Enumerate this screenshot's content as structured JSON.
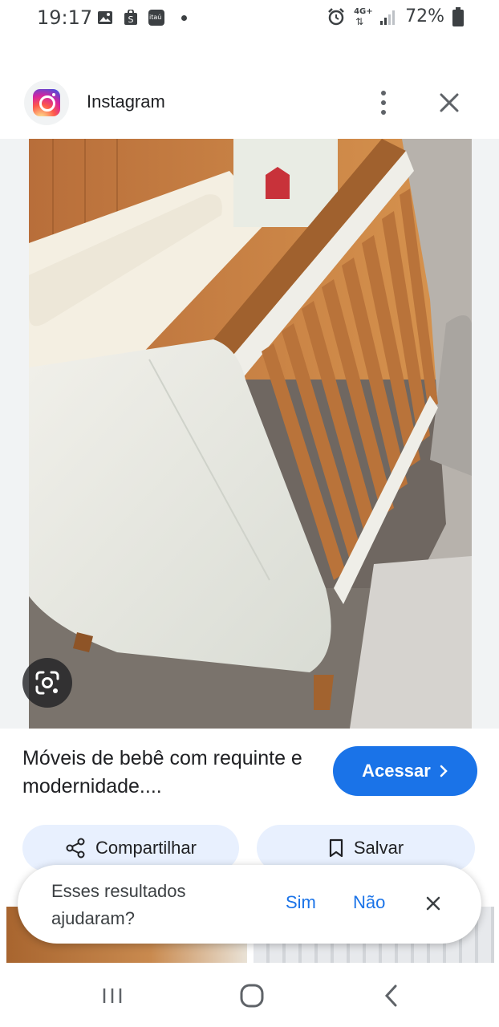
{
  "status": {
    "time": "19:17",
    "battery": "72%",
    "network": "4G+",
    "left_icons": [
      "gallery-icon",
      "shop-icon",
      "itau-icon",
      "dot-icon"
    ],
    "right_icons": [
      "alarm-icon",
      "network-icon",
      "signal-icon",
      "battery-icon"
    ],
    "itau_label": "itaú"
  },
  "header": {
    "source": "Instagram",
    "more_icon": "more-vert-icon",
    "close_icon": "close-icon"
  },
  "image": {
    "lens_icon": "google-lens-icon"
  },
  "caption": {
    "title": "Móveis de bebê com requinte e modernidade....",
    "visit_label": "Acessar"
  },
  "actions": {
    "share_label": "Compartilhar",
    "save_label": "Salvar"
  },
  "feedback": {
    "question": "Esses resultados ajudaram?",
    "yes_label": "Sim",
    "no_label": "Não"
  },
  "colors": {
    "accent": "#1a73e8",
    "chip_bg": "#e8f0fe"
  }
}
